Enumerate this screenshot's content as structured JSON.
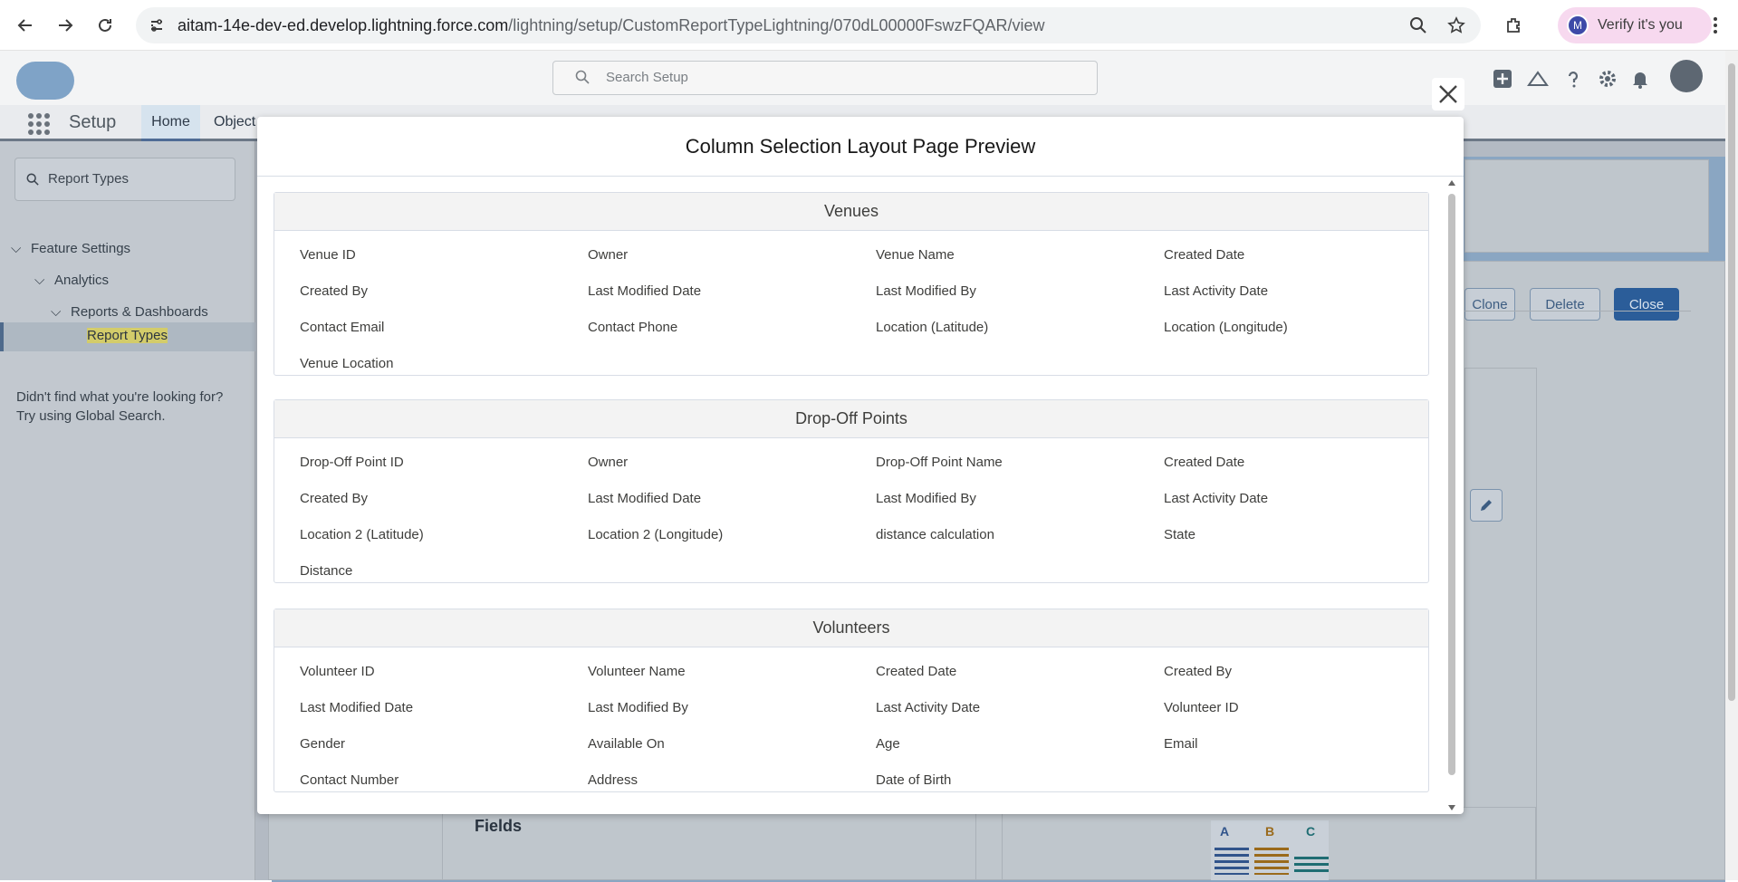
{
  "browser": {
    "url_host": "aitam-14e-dev-ed.develop.lightning.force.com",
    "url_path": "/lightning/setup/CustomReportTypeLightning/070dL00000FswzFQAR/view",
    "profile_initial": "M",
    "verify_label": "Verify it's you"
  },
  "app": {
    "search_placeholder": "Search Setup",
    "setup_label": "Setup",
    "tabs": {
      "home": "Home",
      "object_manager": "Object"
    },
    "quick_find_value": "Report Types",
    "tree": {
      "feature_settings": "Feature Settings",
      "analytics": "Analytics",
      "reports_dashboards": "Reports & Dashboards",
      "report_types": "Report Types"
    },
    "help_line1": "Didn't find what you're looking for?",
    "help_line2": "Try using Global Search.",
    "buttons": {
      "clone": "Clone",
      "delete": "Delete",
      "close": "Close"
    },
    "fields_heading": "Fields",
    "abc": [
      "A",
      "B",
      "C"
    ]
  },
  "modal": {
    "title": "Column Selection Layout Page Preview",
    "sections": [
      {
        "title": "Venues",
        "fields": [
          "Venue ID",
          "Owner",
          "Venue Name",
          "Created Date",
          "Created By",
          "Last Modified Date",
          "Last Modified By",
          "Last Activity Date",
          "Contact Email",
          "Contact Phone",
          "Location (Latitude)",
          "Location (Longitude)",
          "Venue Location"
        ]
      },
      {
        "title": "Drop-Off Points",
        "fields": [
          "Drop-Off Point ID",
          "Owner",
          "Drop-Off Point Name",
          "Created Date",
          "Created By",
          "Last Modified Date",
          "Last Modified By",
          "Last Activity Date",
          "Location 2 (Latitude)",
          "Location 2 (Longitude)",
          "distance calculation",
          "State",
          "Distance"
        ]
      },
      {
        "title": "Volunteers",
        "fields": [
          "Volunteer ID",
          "Volunteer Name",
          "Created Date",
          "Created By",
          "Last Modified Date",
          "Last Modified By",
          "Last Activity Date",
          "Volunteer ID",
          "Gender",
          "Available On",
          "Age",
          "Email",
          "Contact Number",
          "Address",
          "Date of Birth"
        ]
      }
    ]
  }
}
